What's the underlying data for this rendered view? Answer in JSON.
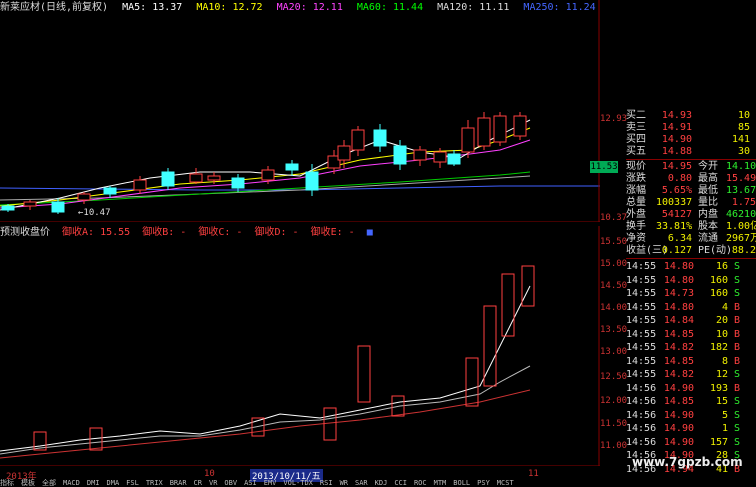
{
  "header": {
    "title": "新莱应材(日线,前复权)",
    "ma": [
      {
        "label": "MA5: 13.37",
        "color": "#ffffff"
      },
      {
        "label": "MA10: 12.72",
        "color": "#ffff00"
      },
      {
        "label": "MA20: 12.11",
        "color": "#ff40ff"
      },
      {
        "label": "MA60: 11.44",
        "color": "#00ff00"
      },
      {
        "label": "MA120: 11.11",
        "color": "#dddddd"
      },
      {
        "label": "MA250: 11.24",
        "color": "#4060ff"
      }
    ]
  },
  "price_axis": [
    "12.93",
    "11.53",
    "10.37"
  ],
  "current_price_tag": "11.53",
  "low_marker": "←10.47",
  "sub_header": {
    "title": "预测收盘价",
    "items": [
      {
        "label": "御收A: 15.55",
        "color": "#ff4040"
      },
      {
        "label": "御收B: -",
        "color": "#ff4040"
      },
      {
        "label": "御收C: -",
        "color": "#ff4040"
      },
      {
        "label": "御收D: -",
        "color": "#ff4040"
      },
      {
        "label": "御收E: -",
        "color": "#ff4040"
      },
      {
        "label": "■",
        "color": "#4040ff"
      }
    ]
  },
  "sub_axis": [
    "15.50",
    "15.00",
    "14.50",
    "14.00",
    "13.50",
    "13.00",
    "12.50",
    "12.00",
    "11.50",
    "11.00"
  ],
  "dates": {
    "left": "2013年",
    "mid": "10",
    "selected": "2013/10/11/五",
    "right": "11"
  },
  "tabs": [
    "指标",
    "模板",
    "全部",
    "MACD",
    "DMI",
    "DMA",
    "FSL",
    "TRIX",
    "BRAR",
    "CR",
    "VR",
    "OBV",
    "ASI",
    "EMV",
    "VOL-TDX",
    "RSI",
    "WR",
    "SAR",
    "KDJ",
    "CCI",
    "ROC",
    "MTM",
    "BOLL",
    "PSY",
    "MCST"
  ],
  "quote": {
    "asks": [
      {
        "label": "卖三",
        "price": "14.91",
        "vol": "85"
      },
      {
        "label": "买四",
        "price": "14.90",
        "vol": "141"
      },
      {
        "label": "买五",
        "price": "14.88",
        "vol": "30"
      }
    ],
    "ask_top": {
      "label": "买二",
      "price": "14.93",
      "vol": "10"
    },
    "rows": [
      {
        "l1": "现价",
        "v1": "14.95",
        "c1": "red",
        "l2": "今开",
        "v2": "14.10",
        "c2": "green"
      },
      {
        "l1": "涨跌",
        "v1": "0.80",
        "c1": "red",
        "l2": "最高",
        "v2": "15.49",
        "c2": "red"
      },
      {
        "l1": "涨幅",
        "v1": "5.65%",
        "c1": "red",
        "l2": "最低",
        "v2": "13.67",
        "c2": "green"
      },
      {
        "l1": "总量",
        "v1": "100337",
        "c1": "yellow",
        "l2": "量比",
        "v2": "1.75",
        "c2": "red"
      },
      {
        "l1": "外盘",
        "v1": "54127",
        "c1": "red",
        "l2": "内盘",
        "v2": "46210",
        "c2": "green"
      },
      {
        "l1": "换手",
        "v1": "33.81%",
        "c1": "yellow",
        "l2": "股本",
        "v2": "1.00亿",
        "c2": "yellow"
      },
      {
        "l1": "净资",
        "v1": "6.34",
        "c1": "yellow",
        "l2": "流通",
        "v2": "2967万",
        "c2": "yellow"
      },
      {
        "l1": "收益(三)",
        "v1": "0.127",
        "c1": "yellow",
        "l2": "PE(动)",
        "v2": "88.2",
        "c2": "yellow"
      }
    ],
    "ticks": [
      {
        "t": "14:55",
        "p": "14.80",
        "q": "16",
        "s": "S"
      },
      {
        "t": "14:55",
        "p": "14.80",
        "q": "160",
        "s": "S"
      },
      {
        "t": "14:55",
        "p": "14.73",
        "q": "160",
        "s": "S"
      },
      {
        "t": "14:55",
        "p": "14.80",
        "q": "4",
        "s": "B"
      },
      {
        "t": "14:55",
        "p": "14.84",
        "q": "20",
        "s": "B"
      },
      {
        "t": "14:55",
        "p": "14.85",
        "q": "10",
        "s": "B"
      },
      {
        "t": "14:55",
        "p": "14.82",
        "q": "182",
        "s": "B"
      },
      {
        "t": "14:55",
        "p": "14.85",
        "q": "8",
        "s": "B"
      },
      {
        "t": "14:55",
        "p": "14.82",
        "q": "12",
        "s": "S"
      },
      {
        "t": "14:56",
        "p": "14.90",
        "q": "193",
        "s": "B"
      },
      {
        "t": "14:56",
        "p": "14.85",
        "q": "15",
        "s": "S"
      },
      {
        "t": "14:56",
        "p": "14.90",
        "q": "5",
        "s": "S"
      },
      {
        "t": "14:56",
        "p": "14.90",
        "q": "1",
        "s": "S"
      },
      {
        "t": "14:56",
        "p": "14.90",
        "q": "157",
        "s": "S"
      },
      {
        "t": "14:56",
        "p": "14.90",
        "q": "28",
        "s": "S"
      },
      {
        "t": "14:56",
        "p": "14.94",
        "q": "41",
        "s": "B"
      }
    ]
  },
  "watermark": "www.7gpzb.com",
  "colors": {
    "up": "#ff4040",
    "down": "#40ffff",
    "bg": "#000000"
  }
}
